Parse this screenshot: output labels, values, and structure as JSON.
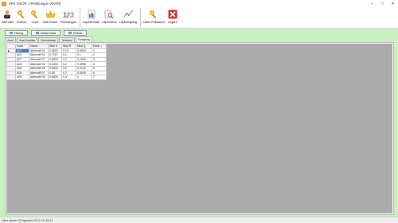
{
  "window": {
    "title": "SPK VIKOR - [Perhitungan VIKOR]",
    "controls": [
      "–",
      "□",
      "✕"
    ]
  },
  "toolbar": {
    "items": [
      {
        "label": "Alternatif",
        "icon": "person-icon"
      },
      {
        "label": "Kriteria",
        "icon": "key-icon"
      },
      {
        "label": "Crips",
        "icon": "key-icon"
      },
      {
        "label": "Nilai Bobot",
        "icon": "crown-icon"
      },
      {
        "label": "Perhitungan",
        "icon": "numbers-icon"
      },
      {
        "label": "LapAlternatif",
        "icon": "report-icon"
      },
      {
        "label": "LapKriteria",
        "icon": "report-search-icon"
      },
      {
        "label": "LapRangking",
        "icon": "chart-icon"
      },
      {
        "label": "Ubah Password",
        "icon": "key-icon"
      },
      {
        "label": "Logout",
        "icon": "close-icon"
      }
    ]
  },
  "actions": {
    "hitung": "Hitung",
    "detail": "Detail Hasil",
    "keluar": "Keluar"
  },
  "tabs": [
    "Awal",
    "Hasil Analisa",
    "Normalisasi",
    "Terbobot",
    "Rangking"
  ],
  "table": {
    "headers": [
      "Kode",
      "Nama",
      "Nilai S",
      "Nilai R",
      "Nilai Q",
      "Rank"
    ],
    "sort_indicator": "▲",
    "rows": [
      [
        "A01",
        "Alternatif 01",
        "0.5833",
        "0.15",
        "0.0909",
        "1"
      ],
      [
        "A02",
        "Alternatif 02",
        "0.7167",
        "0.2",
        "0.1",
        "2"
      ],
      [
        "A07",
        "Alternatif 07",
        "0.5833",
        "0.2",
        "0.1909",
        "3"
      ],
      [
        "A03",
        "Alternatif 04",
        "0.6333",
        "0.2",
        "0.3955",
        "4"
      ],
      [
        "A06",
        "Alternatif 06",
        "0.5833",
        "0.2",
        "0.4742",
        "5"
      ],
      [
        "A08",
        "Alternatif 07",
        "0.85",
        "0.2",
        "0.5045",
        "6"
      ],
      [
        "A05",
        "Alternatif 05",
        "0.6833",
        "0.4",
        "1",
        "7"
      ]
    ]
  },
  "status": {
    "text": "User admin  05 Agustus 2022 22:48:41"
  },
  "colors": {
    "green_background": "#c8f0c0",
    "selection": "#3e7fd6",
    "grid_gray": "#ababab"
  }
}
